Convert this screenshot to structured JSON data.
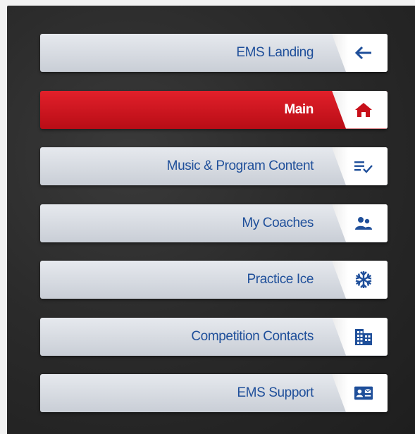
{
  "menu": {
    "items": [
      {
        "label": "EMS Landing",
        "icon": "arrow-left-icon",
        "active": false
      },
      {
        "label": "Main",
        "icon": "home-icon",
        "active": true
      },
      {
        "label": "Music & Program Content",
        "icon": "list-check-icon",
        "active": false
      },
      {
        "label": "My Coaches",
        "icon": "people-icon",
        "active": false
      },
      {
        "label": "Practice Ice",
        "icon": "snowflake-icon",
        "active": false
      },
      {
        "label": "Competition Contacts",
        "icon": "building-icon",
        "active": false
      },
      {
        "label": "EMS Support",
        "icon": "contact-card-icon",
        "active": false
      }
    ]
  },
  "colors": {
    "label_blue": "#1f4f9a",
    "icon_blue": "#1f4f9a",
    "active_red": "#d41a23",
    "home_icon_red": "#c8101a"
  }
}
